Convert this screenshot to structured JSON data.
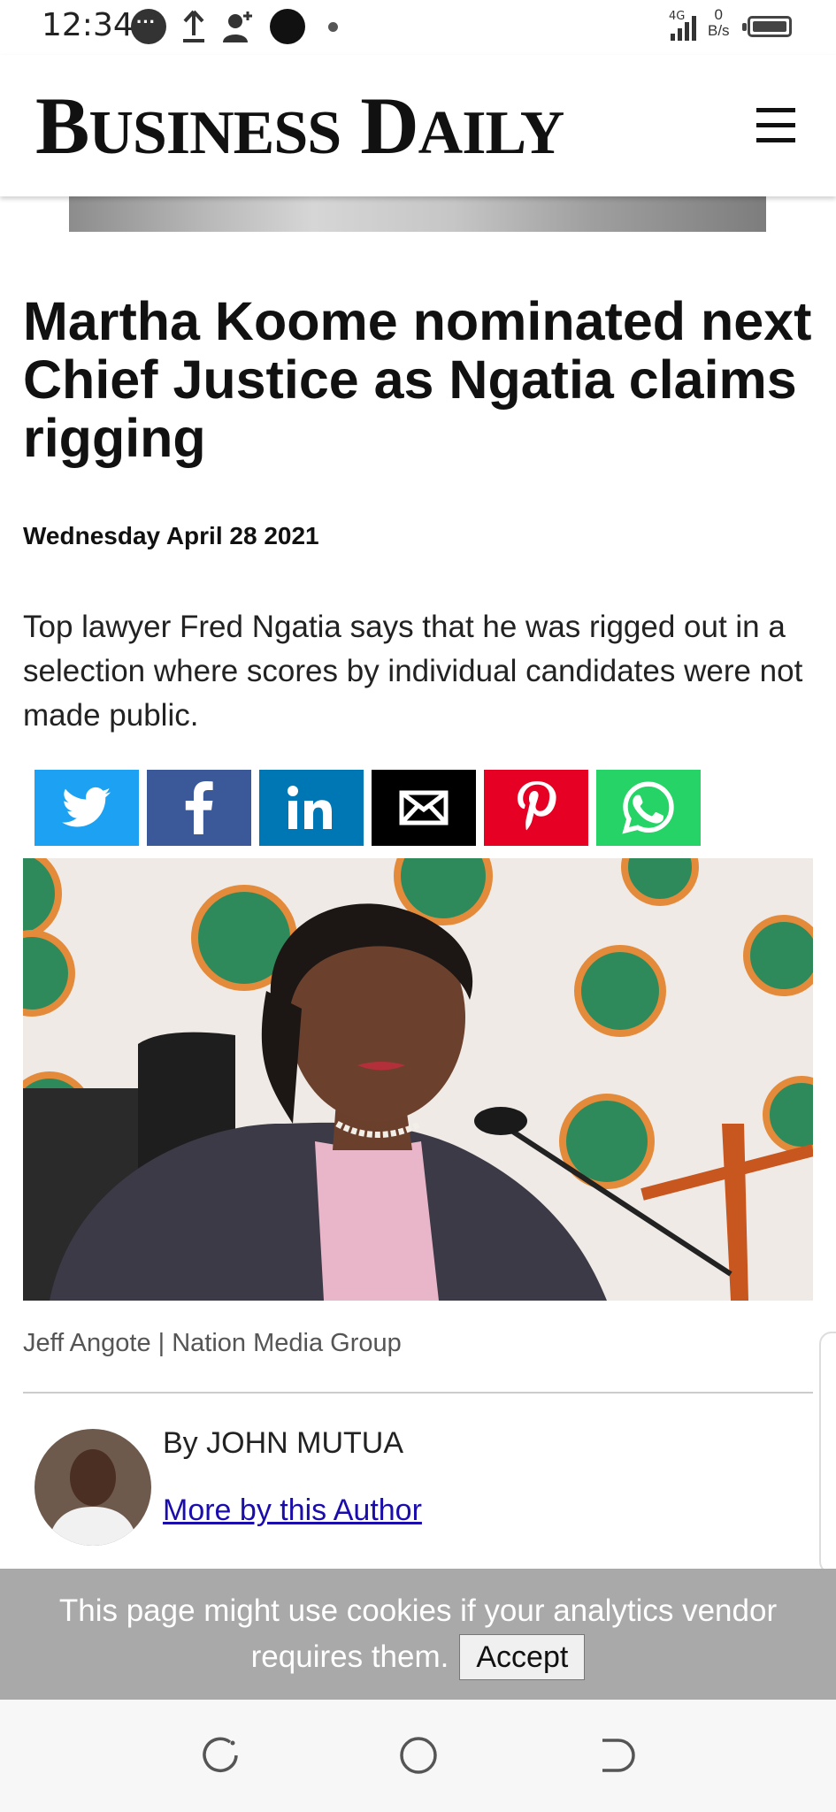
{
  "status_bar": {
    "time": "12:34",
    "network": "4G",
    "speed_value": "0",
    "speed_unit": "B/s",
    "icons": [
      "chat-icon",
      "upload-icon",
      "add-contact-icon",
      "dot-icon",
      "signal-icon",
      "battery-icon"
    ]
  },
  "site": {
    "logo_b": "B",
    "logo_usiness": "USINESS",
    "logo_d": "D",
    "logo_aily": "AILY",
    "menu_icon": "hamburger-menu-icon"
  },
  "article": {
    "headline": "Martha Koome nominated next Chief Justice as Ngatia claims rigging",
    "date": "Wednesday April 28 2021",
    "summary": "Top lawyer Fred Ngatia says that he was rigged out in a selection where scores by individual candidates were not made public.",
    "photo_caption": "Jeff Angote | Nation Media Group",
    "byline": "By JOHN MUTUA",
    "more_by_author": "More by this Author"
  },
  "share_buttons": [
    {
      "name": "twitter",
      "color": "#1da1f2"
    },
    {
      "name": "facebook",
      "color": "#3b5998"
    },
    {
      "name": "linkedin",
      "color": "#0077b5"
    },
    {
      "name": "email",
      "color": "#000000"
    },
    {
      "name": "pinterest",
      "color": "#e60023"
    },
    {
      "name": "whatsapp",
      "color": "#25d366"
    }
  ],
  "cookie_banner": {
    "line1": "This page might use cookies if your analytics vendor",
    "line2": "requires them.",
    "accept_label": "Accept"
  },
  "nav_bar": {
    "icons": [
      "recent-apps-icon",
      "home-icon",
      "back-icon"
    ]
  }
}
